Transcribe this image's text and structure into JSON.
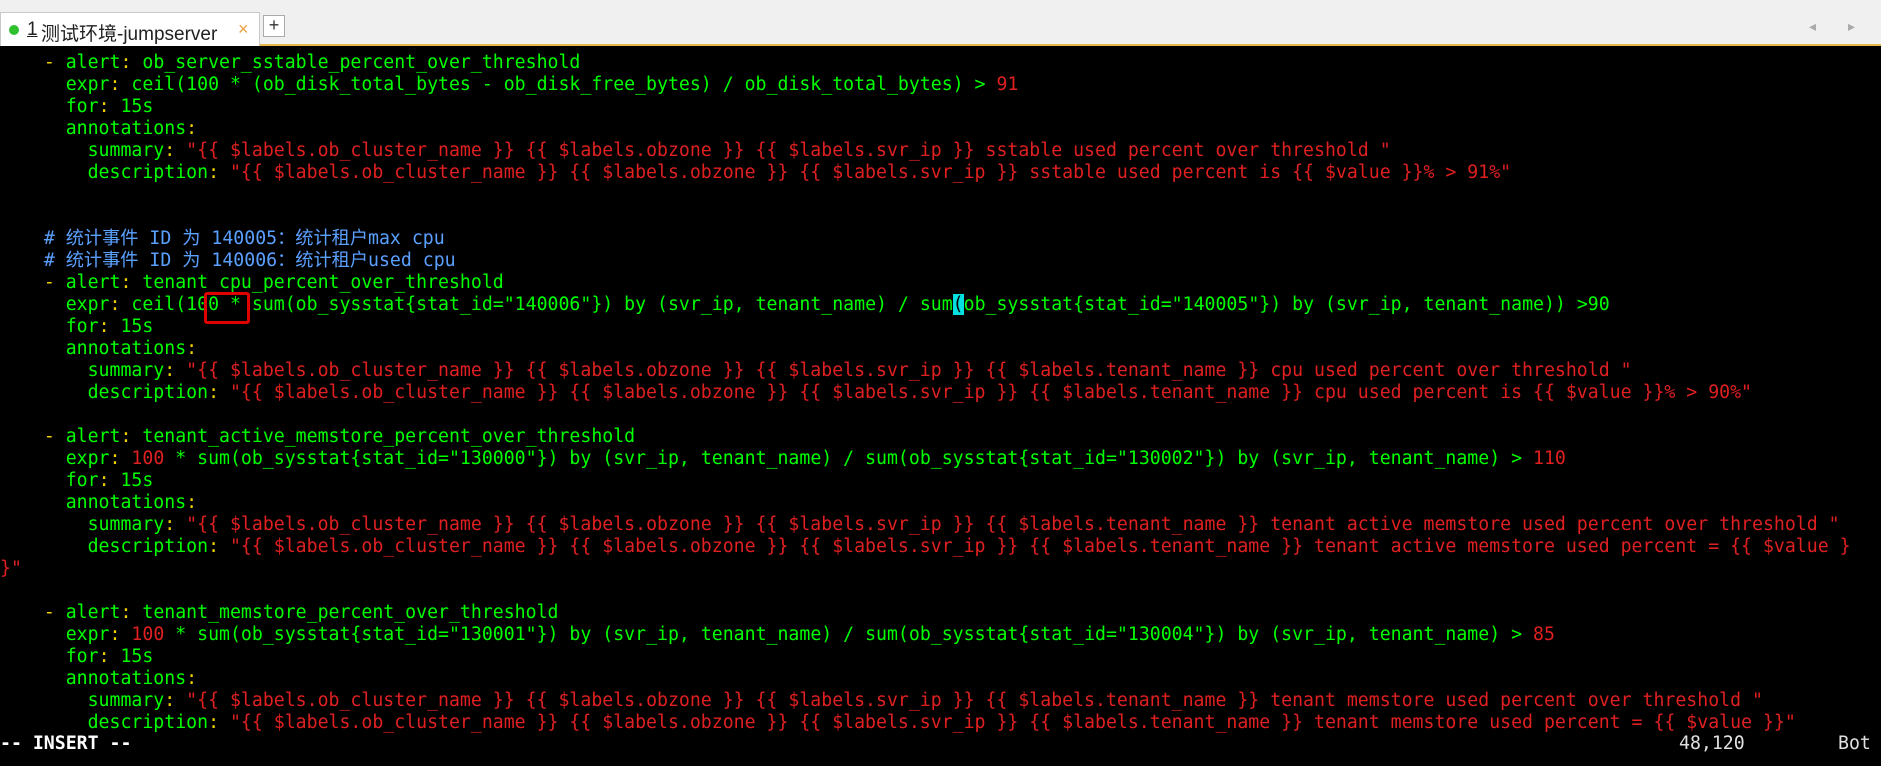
{
  "tab": {
    "number": "1",
    "title": "测试环境-jumpserver",
    "close": "×",
    "new": "+",
    "arrows": "◂ ▸"
  },
  "editor": {
    "mode": "-- INSERT --",
    "position": "48,120",
    "scroll": "Bot"
  },
  "lines": [
    {
      "segs": [
        [
          "    ",
          "w"
        ],
        [
          "- ",
          "y"
        ],
        [
          "alert",
          "g"
        ],
        [
          ": ",
          "y"
        ],
        [
          "ob_server_sstable_percent_over_threshold",
          "g"
        ]
      ]
    },
    {
      "segs": [
        [
          "      ",
          "w"
        ],
        [
          "expr",
          "g"
        ],
        [
          ": ",
          "y"
        ],
        [
          "ceil(100 * (ob_disk_total_bytes - ob_disk_free_bytes) / ob_disk_total_bytes) > ",
          "g"
        ],
        [
          "91",
          "r"
        ]
      ]
    },
    {
      "segs": [
        [
          "      ",
          "w"
        ],
        [
          "for",
          "g"
        ],
        [
          ": ",
          "y"
        ],
        [
          "15s",
          "g"
        ]
      ]
    },
    {
      "segs": [
        [
          "      ",
          "w"
        ],
        [
          "annotations",
          "g"
        ],
        [
          ":",
          "y"
        ]
      ]
    },
    {
      "segs": [
        [
          "        ",
          "w"
        ],
        [
          "summary",
          "g"
        ],
        [
          ": ",
          "y"
        ],
        [
          "\"{{ $labels.ob_cluster_name }} {{ $labels.obzone }} {{ $labels.svr_ip }} sstable used percent over threshold \"",
          "r"
        ]
      ]
    },
    {
      "segs": [
        [
          "        ",
          "w"
        ],
        [
          "description",
          "g"
        ],
        [
          ": ",
          "y"
        ],
        [
          "\"{{ $labels.ob_cluster_name }} {{ $labels.obzone }} {{ $labels.svr_ip }} sstable used percent is {{ $value }}% > 91%\"",
          "r"
        ]
      ]
    },
    {
      "segs": []
    },
    {
      "segs": []
    },
    {
      "segs": [
        [
          "    ",
          "w"
        ],
        [
          "# 统计事件 ID 为 140005：统计租户max cpu",
          "b"
        ]
      ]
    },
    {
      "segs": [
        [
          "    ",
          "w"
        ],
        [
          "# 统计事件 ID 为 140006：统计租户used cpu",
          "b"
        ]
      ]
    },
    {
      "segs": [
        [
          "    ",
          "w"
        ],
        [
          "- ",
          "y"
        ],
        [
          "alert",
          "g"
        ],
        [
          ": ",
          "y"
        ],
        [
          "tenant_cpu_percent_over_threshold",
          "g"
        ]
      ]
    },
    {
      "segs": [
        [
          "      ",
          "w"
        ],
        [
          "expr",
          "g"
        ],
        [
          ": ",
          "y"
        ],
        [
          "ceil(",
          "g"
        ],
        [
          "100",
          "g"
        ],
        [
          " * sum(ob_sysstat{stat_id=\"140006\"}) by (svr_ip, tenant_name) / sum",
          "g"
        ],
        [
          "(",
          "cursor"
        ],
        [
          "ob_sysstat{stat_id=\"140005\"}",
          "g"
        ],
        [
          ")",
          "g"
        ],
        [
          " by (svr_ip, tenant_name)) >90",
          "g"
        ]
      ]
    },
    {
      "segs": [
        [
          "      ",
          "w"
        ],
        [
          "for",
          "g"
        ],
        [
          ": ",
          "y"
        ],
        [
          "15s",
          "g"
        ]
      ]
    },
    {
      "segs": [
        [
          "      ",
          "w"
        ],
        [
          "annotations",
          "g"
        ],
        [
          ":",
          "y"
        ]
      ]
    },
    {
      "segs": [
        [
          "        ",
          "w"
        ],
        [
          "summary",
          "g"
        ],
        [
          ": ",
          "y"
        ],
        [
          "\"{{ $labels.ob_cluster_name }} {{ $labels.obzone }} {{ $labels.svr_ip }} {{ $labels.tenant_name }} cpu used percent over threshold \"",
          "r"
        ]
      ]
    },
    {
      "segs": [
        [
          "        ",
          "w"
        ],
        [
          "description",
          "g"
        ],
        [
          ": ",
          "y"
        ],
        [
          "\"{{ $labels.ob_cluster_name }} {{ $labels.obzone }} {{ $labels.svr_ip }} {{ $labels.tenant_name }} cpu used percent is {{ $value }}% > 90%\"",
          "r"
        ]
      ]
    },
    {
      "segs": []
    },
    {
      "segs": [
        [
          "    ",
          "w"
        ],
        [
          "- ",
          "y"
        ],
        [
          "alert",
          "g"
        ],
        [
          ": ",
          "y"
        ],
        [
          "tenant_active_memstore_percent_over_threshold",
          "g"
        ]
      ]
    },
    {
      "segs": [
        [
          "      ",
          "w"
        ],
        [
          "expr",
          "g"
        ],
        [
          ": ",
          "y"
        ],
        [
          "100",
          "r"
        ],
        [
          " * sum(ob_sysstat{stat_id=\"130000\"}) by (svr_ip, tenant_name) / sum(ob_sysstat{stat_id=\"130002\"}) by (svr_ip, tenant_name) > ",
          "g"
        ],
        [
          "110",
          "r"
        ]
      ]
    },
    {
      "segs": [
        [
          "      ",
          "w"
        ],
        [
          "for",
          "g"
        ],
        [
          ": ",
          "y"
        ],
        [
          "15s",
          "g"
        ]
      ]
    },
    {
      "segs": [
        [
          "      ",
          "w"
        ],
        [
          "annotations",
          "g"
        ],
        [
          ":",
          "y"
        ]
      ]
    },
    {
      "segs": [
        [
          "        ",
          "w"
        ],
        [
          "summary",
          "g"
        ],
        [
          ": ",
          "y"
        ],
        [
          "\"{{ $labels.ob_cluster_name }} {{ $labels.obzone }} {{ $labels.svr_ip }} {{ $labels.tenant_name }} tenant active memstore used percent over threshold \"",
          "r"
        ]
      ]
    },
    {
      "segs": [
        [
          "        ",
          "w"
        ],
        [
          "description",
          "g"
        ],
        [
          ": ",
          "y"
        ],
        [
          "\"{{ $labels.ob_cluster_name }} {{ $labels.obzone }} {{ $labels.svr_ip }} {{ $labels.tenant_name }} tenant active memstore used percent = {{ $value }",
          "r"
        ]
      ]
    },
    {
      "segs": [
        [
          "}\"",
          "r"
        ]
      ]
    },
    {
      "segs": []
    },
    {
      "segs": [
        [
          "    ",
          "w"
        ],
        [
          "- ",
          "y"
        ],
        [
          "alert",
          "g"
        ],
        [
          ": ",
          "y"
        ],
        [
          "tenant_memstore_percent_over_threshold",
          "g"
        ]
      ]
    },
    {
      "segs": [
        [
          "      ",
          "w"
        ],
        [
          "expr",
          "g"
        ],
        [
          ": ",
          "y"
        ],
        [
          "100",
          "r"
        ],
        [
          " * sum(ob_sysstat{stat_id=\"130001\"}) by (svr_ip, tenant_name) / sum(ob_sysstat{stat_id=\"130004\"}) by (svr_ip, tenant_name) > ",
          "g"
        ],
        [
          "85",
          "r"
        ]
      ]
    },
    {
      "segs": [
        [
          "      ",
          "w"
        ],
        [
          "for",
          "g"
        ],
        [
          ": ",
          "y"
        ],
        [
          "15s",
          "g"
        ]
      ]
    },
    {
      "segs": [
        [
          "      ",
          "w"
        ],
        [
          "annotations",
          "g"
        ],
        [
          ":",
          "y"
        ]
      ]
    },
    {
      "segs": [
        [
          "        ",
          "w"
        ],
        [
          "summary",
          "g"
        ],
        [
          ": ",
          "y"
        ],
        [
          "\"{{ $labels.ob_cluster_name }} {{ $labels.obzone }} {{ $labels.svr_ip }} {{ $labels.tenant_name }} tenant memstore used percent over threshold \"",
          "r"
        ]
      ]
    },
    {
      "segs": [
        [
          "        ",
          "w"
        ],
        [
          "description",
          "g"
        ],
        [
          ": ",
          "y"
        ],
        [
          "\"{{ $labels.ob_cluster_name }} {{ $labels.obzone }} {{ $labels.svr_ip }} {{ $labels.tenant_name }} tenant memstore used percent = {{ $value }}\"",
          "r"
        ]
      ]
    }
  ],
  "colors": {
    "background": "#000000",
    "key": "#00ff00",
    "punct": "#f0d000",
    "string": "#e02020",
    "comment": "#5aa0ff",
    "cursor": "#00e0e0",
    "highlight_box": "#e00000"
  }
}
